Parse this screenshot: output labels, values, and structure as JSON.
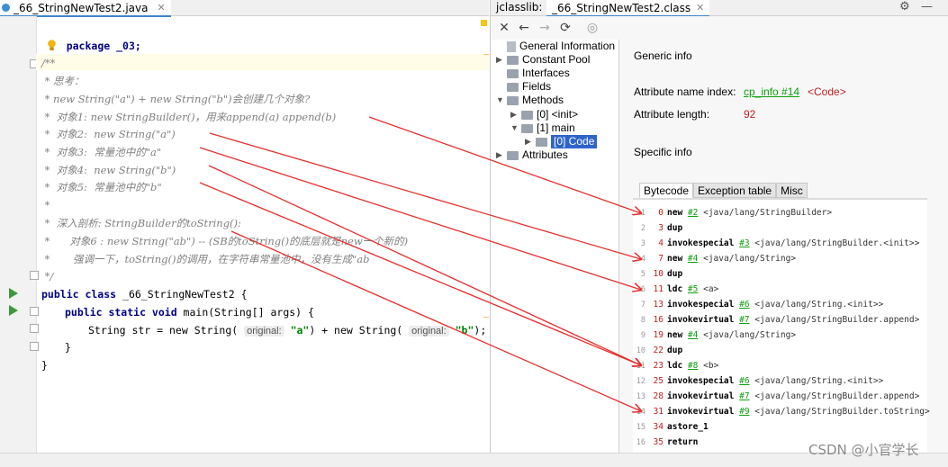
{
  "editor": {
    "tab_title": "_66_StringNewTest2.java",
    "lines": {
      "l1": "package _03;",
      "l3": "/**",
      "l4": " * 思考：",
      "l5": " * new String(\"a\") + new String(\"b\")会创建几个对象?",
      "l6": " *  对象1: new StringBuilder()，用来append(a) append(b)",
      "l7": " *  对象2:  new String(\"a\")",
      "l8": " *  对象3:  常量池中的\"a\"",
      "l9": " *  对象4:  new String(\"b\")",
      "l10": " *  对象5:  常量池中的\"b\"",
      "l11": " *",
      "l12": " *  深入剖析: StringBuilder的toString():",
      "l13": " *      对象6 : new String(\"ab\") -- (SB的toString()的底层就是new一个新的)",
      "l14": " *       强调一下，toString()的调用，在字符串常量池中，没有生成\"ab",
      "l15": " */",
      "class_kw": "public class",
      "class_name": " _66_StringNewTest2 {",
      "main_kw": "public static void",
      "main_sig": " main(String[] args) {",
      "str_decl": "String str = new String(",
      "hint1": "original:",
      "val_a": "\"a\"",
      "mid": ") + new String(",
      "hint2": "original:",
      "val_b": "\"b\"",
      "end": ");",
      "close1": "}",
      "close2": "}"
    }
  },
  "jclasslib": {
    "label": "jclasslib:",
    "tab_title": "_66_StringNewTest2.class",
    "tree": {
      "general": "General Information",
      "constant_pool": "Constant Pool",
      "interfaces": "Interfaces",
      "fields": "Fields",
      "methods": "Methods",
      "init": "[0] <init>",
      "main": "[1] main",
      "code": "[0] Code",
      "attributes": "Attributes"
    },
    "generic_info": "Generic info",
    "attr_name_label": "Attribute name index:",
    "attr_name_link": "cp_info #14",
    "attr_name_value": "<Code>",
    "attr_len_label": "Attribute length:",
    "attr_len_value": "92",
    "specific_info": "Specific info",
    "tabs": [
      "Bytecode",
      "Exception table",
      "Misc"
    ],
    "bytecode": [
      {
        "ln": "1",
        "off": "0",
        "op": "new",
        "ref": "#2",
        "cm": "<java/lang/StringBuilder>"
      },
      {
        "ln": "2",
        "off": "3",
        "op": "dup",
        "ref": "",
        "cm": ""
      },
      {
        "ln": "3",
        "off": "4",
        "op": "invokespecial",
        "ref": "#3",
        "cm": "<java/lang/StringBuilder.<init>>"
      },
      {
        "ln": "4",
        "off": "7",
        "op": "new",
        "ref": "#4",
        "cm": "<java/lang/String>"
      },
      {
        "ln": "5",
        "off": "10",
        "op": "dup",
        "ref": "",
        "cm": ""
      },
      {
        "ln": "6",
        "off": "11",
        "op": "ldc",
        "ref": "#5",
        "cm": "<a>"
      },
      {
        "ln": "7",
        "off": "13",
        "op": "invokespecial",
        "ref": "#6",
        "cm": "<java/lang/String.<init>>"
      },
      {
        "ln": "8",
        "off": "16",
        "op": "invokevirtual",
        "ref": "#7",
        "cm": "<java/lang/StringBuilder.append>"
      },
      {
        "ln": "9",
        "off": "19",
        "op": "new",
        "ref": "#4",
        "cm": "<java/lang/String>"
      },
      {
        "ln": "10",
        "off": "22",
        "op": "dup",
        "ref": "",
        "cm": ""
      },
      {
        "ln": "11",
        "off": "23",
        "op": "ldc",
        "ref": "#8",
        "cm": "<b>"
      },
      {
        "ln": "12",
        "off": "25",
        "op": "invokespecial",
        "ref": "#6",
        "cm": "<java/lang/String.<init>>"
      },
      {
        "ln": "13",
        "off": "28",
        "op": "invokevirtual",
        "ref": "#7",
        "cm": "<java/lang/StringBuilder.append>"
      },
      {
        "ln": "14",
        "off": "31",
        "op": "invokevirtual",
        "ref": "#9",
        "cm": "<java/lang/StringBuilder.toString>"
      },
      {
        "ln": "15",
        "off": "34",
        "op": "astore_1",
        "ref": "",
        "cm": ""
      },
      {
        "ln": "16",
        "off": "35",
        "op": "return",
        "ref": "",
        "cm": ""
      }
    ]
  },
  "watermark": "CSDN @小官学长",
  "colors": {
    "arrow": "#e53030",
    "link": "#10a010",
    "offset": "#c02020",
    "selection": "#2f65ca"
  }
}
